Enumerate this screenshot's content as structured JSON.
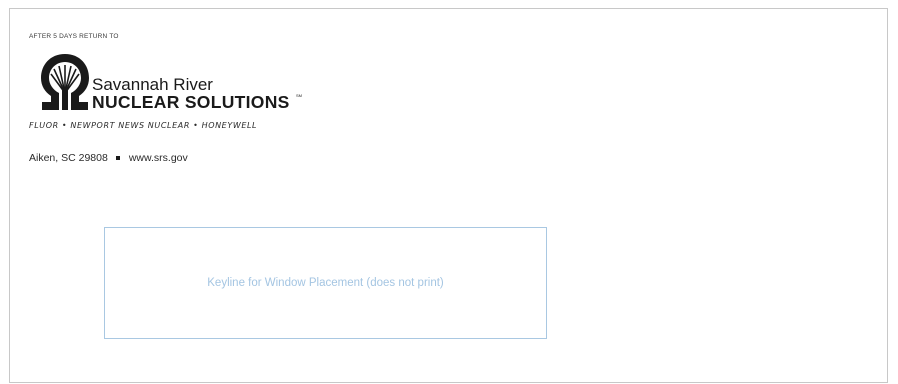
{
  "return_label": "AFTER 5 DAYS RETURN TO",
  "brand": {
    "line1": "Savannah River",
    "line2": "NUCLEAR SOLUTIONS",
    "service_mark": "SM",
    "logo_icon": "srns-logo-icon"
  },
  "partners": "FLUOR • NEWPORT NEWS NUCLEAR • HONEYWELL",
  "address": {
    "city_state_zip": "Aiken, SC 29808",
    "website": "www.srs.gov"
  },
  "keyline": {
    "text": "Keyline for Window Placement (does not print)"
  },
  "colors": {
    "keyline_border": "#a9c8e2",
    "keyline_text": "#a4c5e2",
    "brand": "#1a1a1a",
    "envelope_border": "#c8c8c8"
  }
}
